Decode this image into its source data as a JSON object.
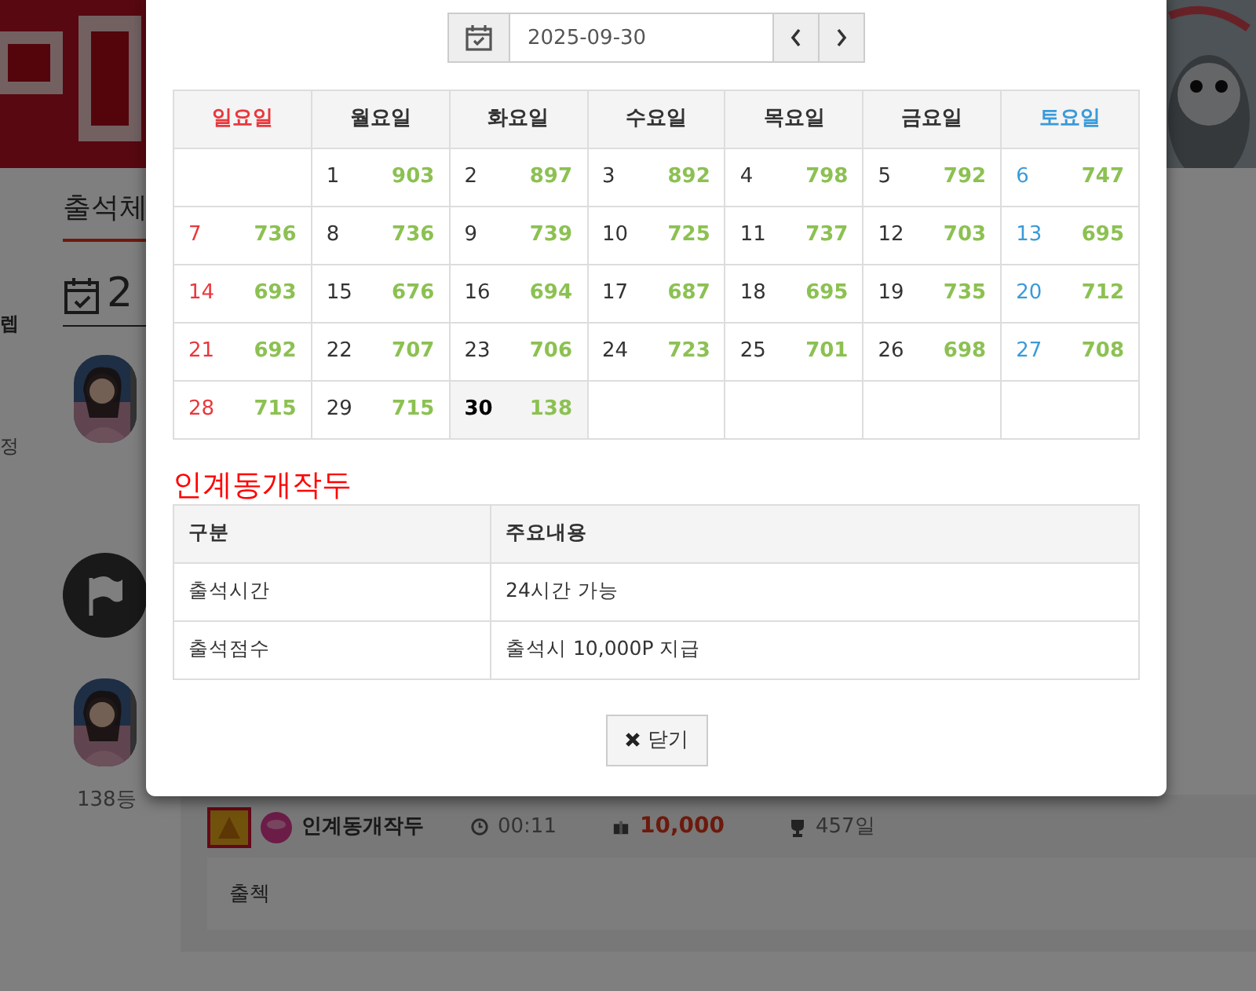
{
  "page": {
    "sidebar_fragments": [
      "렙",
      "정"
    ],
    "section_title": "출석체",
    "date_heading": "2",
    "rank": "138등",
    "post": {
      "name": "인계동개작두",
      "time": "00:11",
      "points": "10,000",
      "days": "457일",
      "comment": "출첵"
    }
  },
  "modal": {
    "date": "2025-09-30",
    "weekdays": [
      {
        "label": "일요일",
        "kind": "sunday"
      },
      {
        "label": "월요일",
        "kind": "weekday"
      },
      {
        "label": "화요일",
        "kind": "weekday"
      },
      {
        "label": "수요일",
        "kind": "weekday"
      },
      {
        "label": "목요일",
        "kind": "weekday"
      },
      {
        "label": "금요일",
        "kind": "weekday"
      },
      {
        "label": "토요일",
        "kind": "saturday"
      }
    ],
    "weeks": [
      [
        {
          "kind": "blank"
        },
        {
          "day": "1",
          "count": "903",
          "selected": false
        },
        {
          "day": "2",
          "count": "897",
          "selected": false
        },
        {
          "day": "3",
          "count": "892",
          "selected": false
        },
        {
          "day": "4",
          "count": "798",
          "selected": false
        },
        {
          "day": "5",
          "count": "792",
          "selected": false
        },
        {
          "day": "6",
          "count": "747",
          "selected": false
        }
      ],
      [
        {
          "day": "7",
          "count": "736",
          "selected": false
        },
        {
          "day": "8",
          "count": "736",
          "selected": false
        },
        {
          "day": "9",
          "count": "739",
          "selected": false
        },
        {
          "day": "10",
          "count": "725",
          "selected": false
        },
        {
          "day": "11",
          "count": "737",
          "selected": false
        },
        {
          "day": "12",
          "count": "703",
          "selected": false
        },
        {
          "day": "13",
          "count": "695",
          "selected": false
        }
      ],
      [
        {
          "day": "14",
          "count": "693",
          "selected": false
        },
        {
          "day": "15",
          "count": "676",
          "selected": false
        },
        {
          "day": "16",
          "count": "694",
          "selected": false
        },
        {
          "day": "17",
          "count": "687",
          "selected": false
        },
        {
          "day": "18",
          "count": "695",
          "selected": false
        },
        {
          "day": "19",
          "count": "735",
          "selected": false
        },
        {
          "day": "20",
          "count": "712",
          "selected": false
        }
      ],
      [
        {
          "day": "21",
          "count": "692",
          "selected": false
        },
        {
          "day": "22",
          "count": "707",
          "selected": false
        },
        {
          "day": "23",
          "count": "706",
          "selected": false
        },
        {
          "day": "24",
          "count": "723",
          "selected": false
        },
        {
          "day": "25",
          "count": "701",
          "selected": false
        },
        {
          "day": "26",
          "count": "698",
          "selected": false
        },
        {
          "day": "27",
          "count": "708",
          "selected": false
        }
      ],
      [
        {
          "day": "28",
          "count": "715",
          "selected": false
        },
        {
          "day": "29",
          "count": "715",
          "selected": false
        },
        {
          "day": "30",
          "count": "138",
          "selected": true
        },
        {
          "kind": "blank"
        },
        {
          "kind": "blank"
        },
        {
          "kind": "blank"
        },
        {
          "kind": "blank"
        }
      ]
    ],
    "info_title": "인계동개작두",
    "info_columns": [
      "구분",
      "주요내용"
    ],
    "info_rows": [
      [
        "출석시간",
        "24시간 가능"
      ],
      [
        "출석점수",
        "출석시 10,000P 지급"
      ]
    ],
    "close_button": "닫기"
  }
}
